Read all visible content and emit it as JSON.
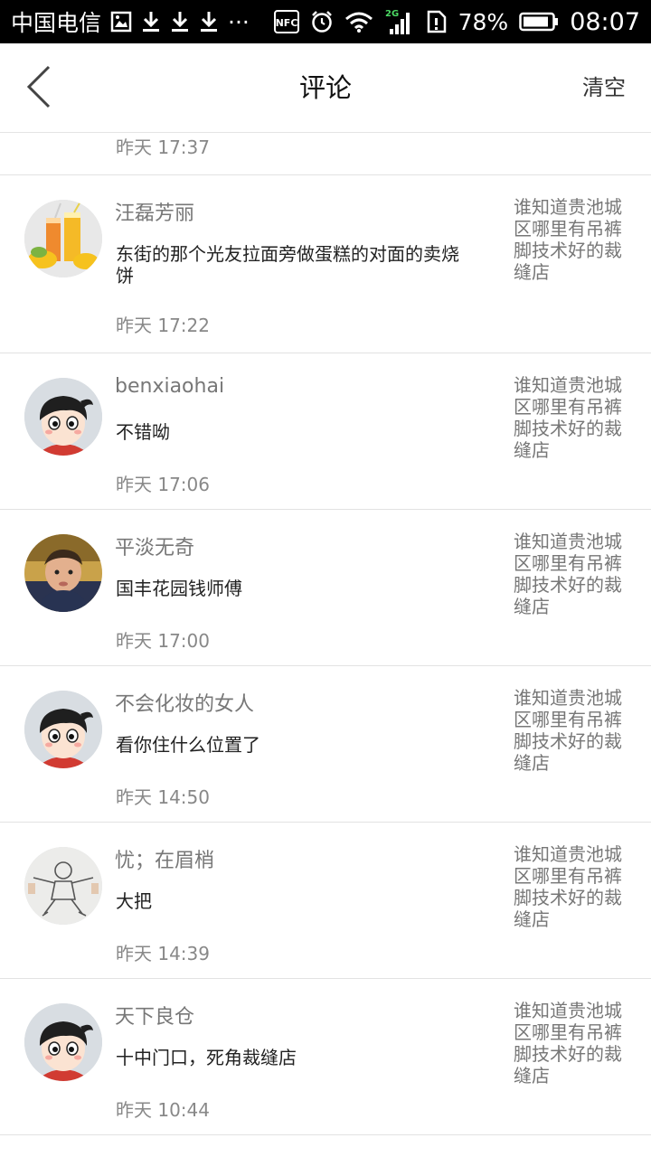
{
  "status_bar": {
    "carrier": "中国电信",
    "dots": "···",
    "nfc": "NFC",
    "network": "2G",
    "battery": "78%",
    "time": "08:07"
  },
  "header": {
    "title": "评论",
    "clear_label": "清空"
  },
  "partial_item": {
    "time": "昨天 17:37"
  },
  "comments": [
    {
      "name": "汪磊芳丽",
      "content": "东街的那个光友拉面旁做蛋糕的对面的卖烧饼",
      "time": "昨天 17:22",
      "ref": "谁知道贵池城区哪里有吊裤脚技术好的裁缝店",
      "avatar": "juice-avatar"
    },
    {
      "name": "benxiaohai",
      "content": "不错呦",
      "time": "昨天 17:06",
      "ref": "谁知道贵池城区哪里有吊裤脚技术好的裁缝店",
      "avatar": "default-avatar"
    },
    {
      "name": "平淡无奇",
      "content": "国丰花园钱师傅",
      "time": "昨天 17:00",
      "ref": "谁知道贵池城区哪里有吊裤脚技术好的裁缝店",
      "avatar": "child-photo-avatar"
    },
    {
      "name": "不会化妆的女人",
      "content": "看你住什么位置了",
      "time": "昨天 14:50",
      "ref": "谁知道贵池城区哪里有吊裤脚技术好的裁缝店",
      "avatar": "default-avatar"
    },
    {
      "name": "忧；在眉梢",
      "content": "大把",
      "time": "昨天 14:39",
      "ref": "谁知道贵池城区哪里有吊裤脚技术好的裁缝店",
      "avatar": "sketch-avatar"
    },
    {
      "name": "天下良仓",
      "content": "十中门口，死角裁缝店",
      "time": "昨天 10:44",
      "ref": "谁知道贵池城区哪里有吊裤脚技术好的裁缝店",
      "avatar": "default-avatar"
    }
  ]
}
